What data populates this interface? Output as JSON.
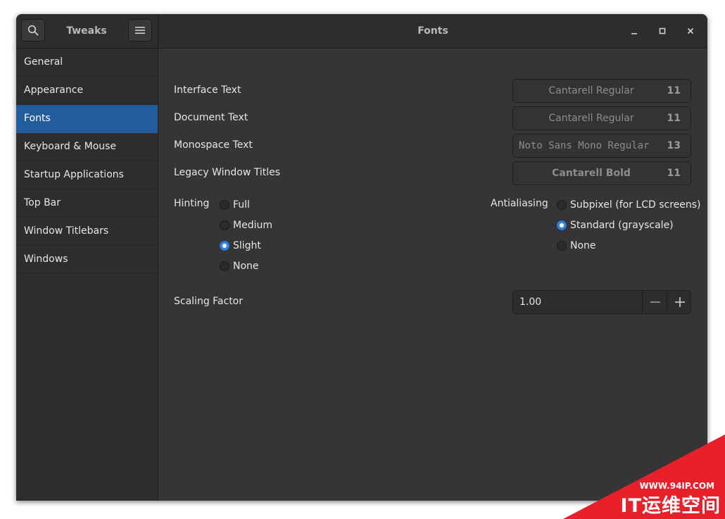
{
  "header": {
    "app_title": "Tweaks",
    "page_title": "Fonts"
  },
  "sidebar": {
    "items": [
      {
        "label": "General"
      },
      {
        "label": "Appearance"
      },
      {
        "label": "Fonts"
      },
      {
        "label": "Keyboard & Mouse"
      },
      {
        "label": "Startup Applications"
      },
      {
        "label": "Top Bar"
      },
      {
        "label": "Window Titlebars"
      },
      {
        "label": "Windows"
      }
    ],
    "active": "Fonts"
  },
  "fonts": {
    "rows": [
      {
        "label": "Interface Text",
        "font": "Cantarell Regular",
        "size": "11"
      },
      {
        "label": "Document Text",
        "font": "Cantarell Regular",
        "size": "11"
      },
      {
        "label": "Monospace Text",
        "font": "Noto Sans Mono Regular",
        "size": "13"
      },
      {
        "label": "Legacy Window Titles",
        "font": "Cantarell Bold",
        "size": "11"
      }
    ]
  },
  "hinting": {
    "label": "Hinting",
    "options": [
      "Full",
      "Medium",
      "Slight",
      "None"
    ],
    "selected": "Slight"
  },
  "antialiasing": {
    "label": "Antialiasing",
    "options": [
      "Subpixel (for LCD screens)",
      "Standard (grayscale)",
      "None"
    ],
    "selected": "Standard (grayscale)"
  },
  "scaling": {
    "label": "Scaling Factor",
    "value": "1.00"
  },
  "watermark": {
    "url": "WWW.94IP.COM",
    "name": "IT运维空间"
  },
  "colors": {
    "accent": "#215d9c",
    "radio_on": "#3584e4",
    "window_bg": "#353535",
    "sidebar_bg": "#2d2d2d",
    "watermark_red": "#e8202a"
  }
}
